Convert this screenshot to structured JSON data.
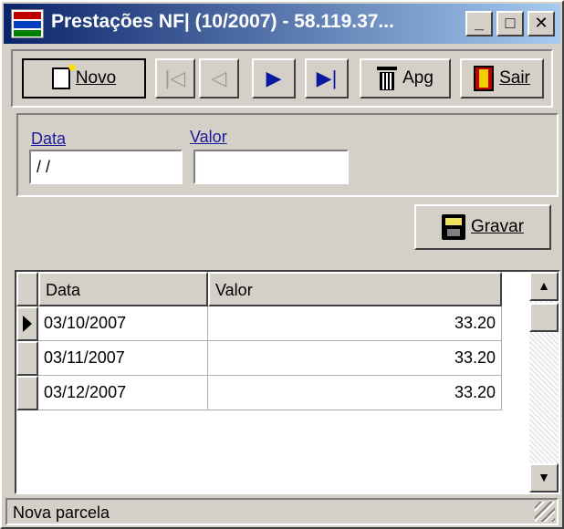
{
  "window": {
    "title": "Prestações NF| (10/2007) - 58.119.37...",
    "minimize_glyph": "_",
    "maximize_glyph": "□",
    "close_glyph": "✕"
  },
  "toolbar": {
    "new_label": "Novo",
    "delete_label": "Apg",
    "exit_label": "Sair",
    "first_glyph": "|◁",
    "prev_glyph": "◁",
    "next_glyph": "▶",
    "last_glyph": "▶|"
  },
  "form": {
    "date_label": "Data",
    "date_value": " / /",
    "value_label": "Valor",
    "value_value": "",
    "save_label": "Gravar"
  },
  "grid": {
    "columns": [
      "Data",
      "Valor"
    ],
    "rows": [
      {
        "date": "03/10/2007",
        "value": "33.20",
        "current": true
      },
      {
        "date": "03/11/2007",
        "value": "33.20",
        "current": false
      },
      {
        "date": "03/12/2007",
        "value": "33.20",
        "current": false
      }
    ],
    "scroll_up_glyph": "▲",
    "scroll_down_glyph": "▼"
  },
  "status": {
    "text": "Nova parcela"
  },
  "colors": {
    "titlebar_start": "#0a246a",
    "titlebar_end": "#a6caf0",
    "face": "#d4d0c8",
    "label_blue": "#1a1a9a"
  }
}
